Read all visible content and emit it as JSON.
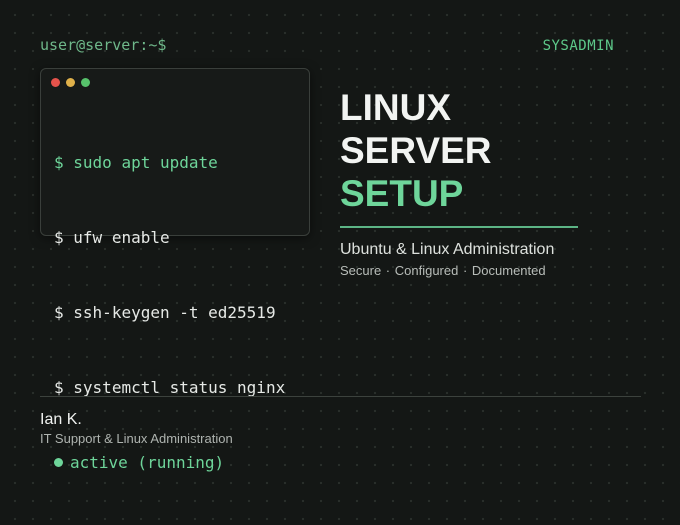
{
  "header": {
    "prompt": "user@server:~$",
    "tag": "SYSADMIN"
  },
  "terminal": {
    "window_dots": [
      "red",
      "yellow",
      "green"
    ],
    "lines": [
      {
        "prefix": "$",
        "text": "sudo apt update"
      },
      {
        "prefix": "$",
        "text": "ufw enable"
      },
      {
        "prefix": "$",
        "text": "ssh-keygen -t ed25519"
      },
      {
        "prefix": "$",
        "text": "systemctl status nginx"
      }
    ],
    "status": "active (running)"
  },
  "title": {
    "line1": "LINUX",
    "line2": "SERVER",
    "line3": "SETUP"
  },
  "subtitle": "Ubuntu & Linux Administration",
  "tagline": "Secure · Configured · Documented",
  "footer": {
    "name": "Ian K.",
    "role": "IT Support & Linux Administration"
  },
  "colors": {
    "background": "#141715",
    "accent": "#6ed59a",
    "text": "#f2f4f2"
  }
}
